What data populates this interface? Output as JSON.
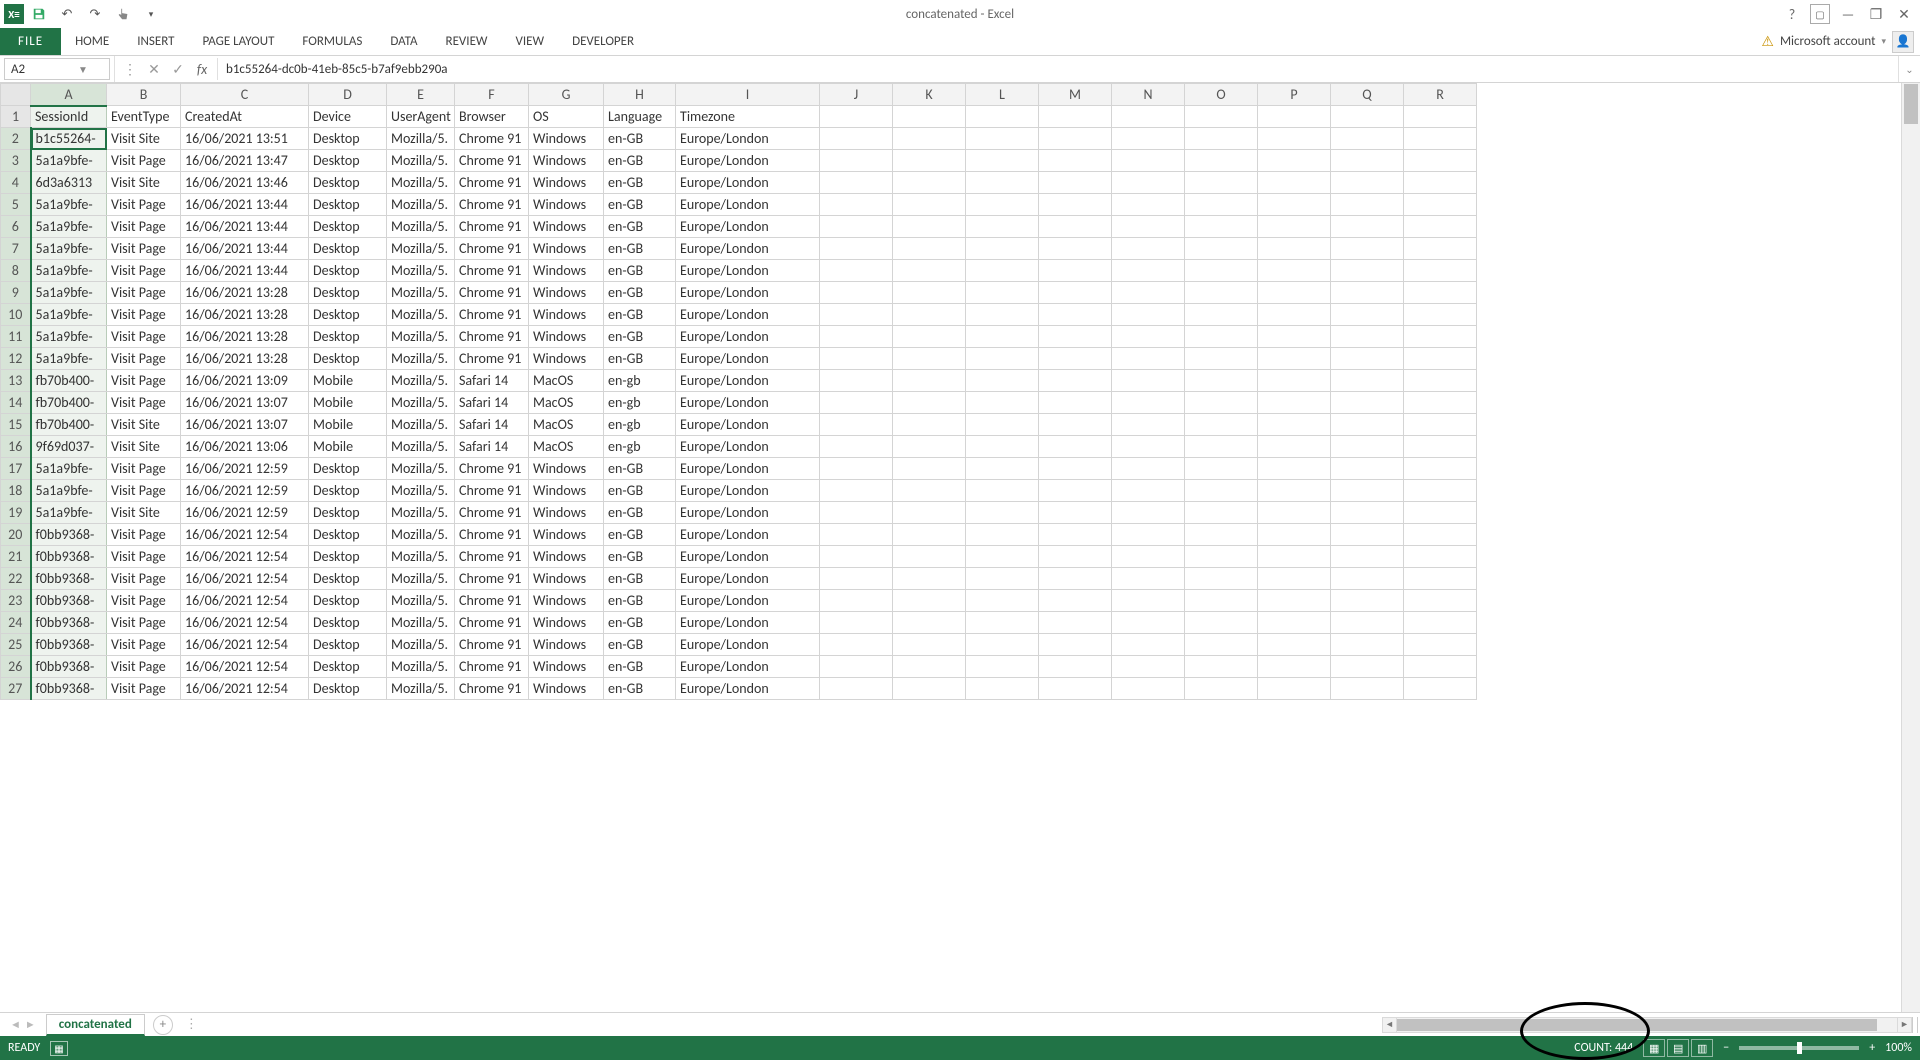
{
  "title": "concatenated - Excel",
  "qat": {
    "undo": "↶",
    "redo": "↷",
    "save": "💾",
    "touch": "☝"
  },
  "ribbon_tabs": [
    "FILE",
    "HOME",
    "INSERT",
    "PAGE LAYOUT",
    "FORMULAS",
    "DATA",
    "REVIEW",
    "VIEW",
    "DEVELOPER"
  ],
  "account_label": "Microsoft account",
  "namebox": "A2",
  "formula": "b1c55264-dc0b-41eb-85c5-b7af9ebb290a",
  "col_headers": [
    "A",
    "B",
    "C",
    "D",
    "E",
    "F",
    "G",
    "H",
    "I",
    "J",
    "K",
    "L",
    "M",
    "N",
    "O",
    "P",
    "Q",
    "R"
  ],
  "columns_row1": [
    "SessionId",
    "EventType",
    "CreatedAt",
    "Device",
    "UserAgent",
    "Browser",
    "OS",
    "Language",
    "Timezone"
  ],
  "rows": [
    {
      "n": 2,
      "c": [
        "b1c55264-",
        "Visit Site",
        "16/06/2021 13:51",
        "Desktop",
        "Mozilla/5.",
        "Chrome 91",
        "Windows",
        "en-GB",
        "Europe/London"
      ]
    },
    {
      "n": 3,
      "c": [
        "5a1a9bfe-",
        "Visit Page",
        "16/06/2021 13:47",
        "Desktop",
        "Mozilla/5.",
        "Chrome 91",
        "Windows",
        "en-GB",
        "Europe/London"
      ]
    },
    {
      "n": 4,
      "c": [
        "6d3a6313",
        "Visit Site",
        "16/06/2021 13:46",
        "Desktop",
        "Mozilla/5.",
        "Chrome 91",
        "Windows",
        "en-GB",
        "Europe/London"
      ]
    },
    {
      "n": 5,
      "c": [
        "5a1a9bfe-",
        "Visit Page",
        "16/06/2021 13:44",
        "Desktop",
        "Mozilla/5.",
        "Chrome 91",
        "Windows",
        "en-GB",
        "Europe/London"
      ]
    },
    {
      "n": 6,
      "c": [
        "5a1a9bfe-",
        "Visit Page",
        "16/06/2021 13:44",
        "Desktop",
        "Mozilla/5.",
        "Chrome 91",
        "Windows",
        "en-GB",
        "Europe/London"
      ]
    },
    {
      "n": 7,
      "c": [
        "5a1a9bfe-",
        "Visit Page",
        "16/06/2021 13:44",
        "Desktop",
        "Mozilla/5.",
        "Chrome 91",
        "Windows",
        "en-GB",
        "Europe/London"
      ]
    },
    {
      "n": 8,
      "c": [
        "5a1a9bfe-",
        "Visit Page",
        "16/06/2021 13:44",
        "Desktop",
        "Mozilla/5.",
        "Chrome 91",
        "Windows",
        "en-GB",
        "Europe/London"
      ]
    },
    {
      "n": 9,
      "c": [
        "5a1a9bfe-",
        "Visit Page",
        "16/06/2021 13:28",
        "Desktop",
        "Mozilla/5.",
        "Chrome 91",
        "Windows",
        "en-GB",
        "Europe/London"
      ]
    },
    {
      "n": 10,
      "c": [
        "5a1a9bfe-",
        "Visit Page",
        "16/06/2021 13:28",
        "Desktop",
        "Mozilla/5.",
        "Chrome 91",
        "Windows",
        "en-GB",
        "Europe/London"
      ]
    },
    {
      "n": 11,
      "c": [
        "5a1a9bfe-",
        "Visit Page",
        "16/06/2021 13:28",
        "Desktop",
        "Mozilla/5.",
        "Chrome 91",
        "Windows",
        "en-GB",
        "Europe/London"
      ]
    },
    {
      "n": 12,
      "c": [
        "5a1a9bfe-",
        "Visit Page",
        "16/06/2021 13:28",
        "Desktop",
        "Mozilla/5.",
        "Chrome 91",
        "Windows",
        "en-GB",
        "Europe/London"
      ]
    },
    {
      "n": 13,
      "c": [
        "fb70b400-",
        "Visit Page",
        "16/06/2021 13:09",
        "Mobile",
        "Mozilla/5.",
        "Safari 14",
        "MacOS",
        "en-gb",
        "Europe/London"
      ]
    },
    {
      "n": 14,
      "c": [
        "fb70b400-",
        "Visit Page",
        "16/06/2021 13:07",
        "Mobile",
        "Mozilla/5.",
        "Safari 14",
        "MacOS",
        "en-gb",
        "Europe/London"
      ]
    },
    {
      "n": 15,
      "c": [
        "fb70b400-",
        "Visit Site",
        "16/06/2021 13:07",
        "Mobile",
        "Mozilla/5.",
        "Safari 14",
        "MacOS",
        "en-gb",
        "Europe/London"
      ]
    },
    {
      "n": 16,
      "c": [
        "9f69d037-",
        "Visit Site",
        "16/06/2021 13:06",
        "Mobile",
        "Mozilla/5.",
        "Safari 14",
        "MacOS",
        "en-gb",
        "Europe/London"
      ]
    },
    {
      "n": 17,
      "c": [
        "5a1a9bfe-",
        "Visit Page",
        "16/06/2021 12:59",
        "Desktop",
        "Mozilla/5.",
        "Chrome 91",
        "Windows",
        "en-GB",
        "Europe/London"
      ]
    },
    {
      "n": 18,
      "c": [
        "5a1a9bfe-",
        "Visit Page",
        "16/06/2021 12:59",
        "Desktop",
        "Mozilla/5.",
        "Chrome 91",
        "Windows",
        "en-GB",
        "Europe/London"
      ]
    },
    {
      "n": 19,
      "c": [
        "5a1a9bfe-",
        "Visit Site",
        "16/06/2021 12:59",
        "Desktop",
        "Mozilla/5.",
        "Chrome 91",
        "Windows",
        "en-GB",
        "Europe/London"
      ]
    },
    {
      "n": 20,
      "c": [
        "f0bb9368-",
        "Visit Page",
        "16/06/2021 12:54",
        "Desktop",
        "Mozilla/5.",
        "Chrome 91",
        "Windows",
        "en-GB",
        "Europe/London"
      ]
    },
    {
      "n": 21,
      "c": [
        "f0bb9368-",
        "Visit Page",
        "16/06/2021 12:54",
        "Desktop",
        "Mozilla/5.",
        "Chrome 91",
        "Windows",
        "en-GB",
        "Europe/London"
      ]
    },
    {
      "n": 22,
      "c": [
        "f0bb9368-",
        "Visit Page",
        "16/06/2021 12:54",
        "Desktop",
        "Mozilla/5.",
        "Chrome 91",
        "Windows",
        "en-GB",
        "Europe/London"
      ]
    },
    {
      "n": 23,
      "c": [
        "f0bb9368-",
        "Visit Page",
        "16/06/2021 12:54",
        "Desktop",
        "Mozilla/5.",
        "Chrome 91",
        "Windows",
        "en-GB",
        "Europe/London"
      ]
    },
    {
      "n": 24,
      "c": [
        "f0bb9368-",
        "Visit Page",
        "16/06/2021 12:54",
        "Desktop",
        "Mozilla/5.",
        "Chrome 91",
        "Windows",
        "en-GB",
        "Europe/London"
      ]
    },
    {
      "n": 25,
      "c": [
        "f0bb9368-",
        "Visit Page",
        "16/06/2021 12:54",
        "Desktop",
        "Mozilla/5.",
        "Chrome 91",
        "Windows",
        "en-GB",
        "Europe/London"
      ]
    },
    {
      "n": 26,
      "c": [
        "f0bb9368-",
        "Visit Page",
        "16/06/2021 12:54",
        "Desktop",
        "Mozilla/5.",
        "Chrome 91",
        "Windows",
        "en-GB",
        "Europe/London"
      ]
    },
    {
      "n": 27,
      "c": [
        "f0bb9368-",
        "Visit Page",
        "16/06/2021 12:54",
        "Desktop",
        "Mozilla/5.",
        "Chrome 91",
        "Windows",
        "en-GB",
        "Europe/London"
      ]
    }
  ],
  "sheet_name": "concatenated",
  "status_ready": "READY",
  "status_count": "COUNT: 444",
  "zoom": "100%"
}
